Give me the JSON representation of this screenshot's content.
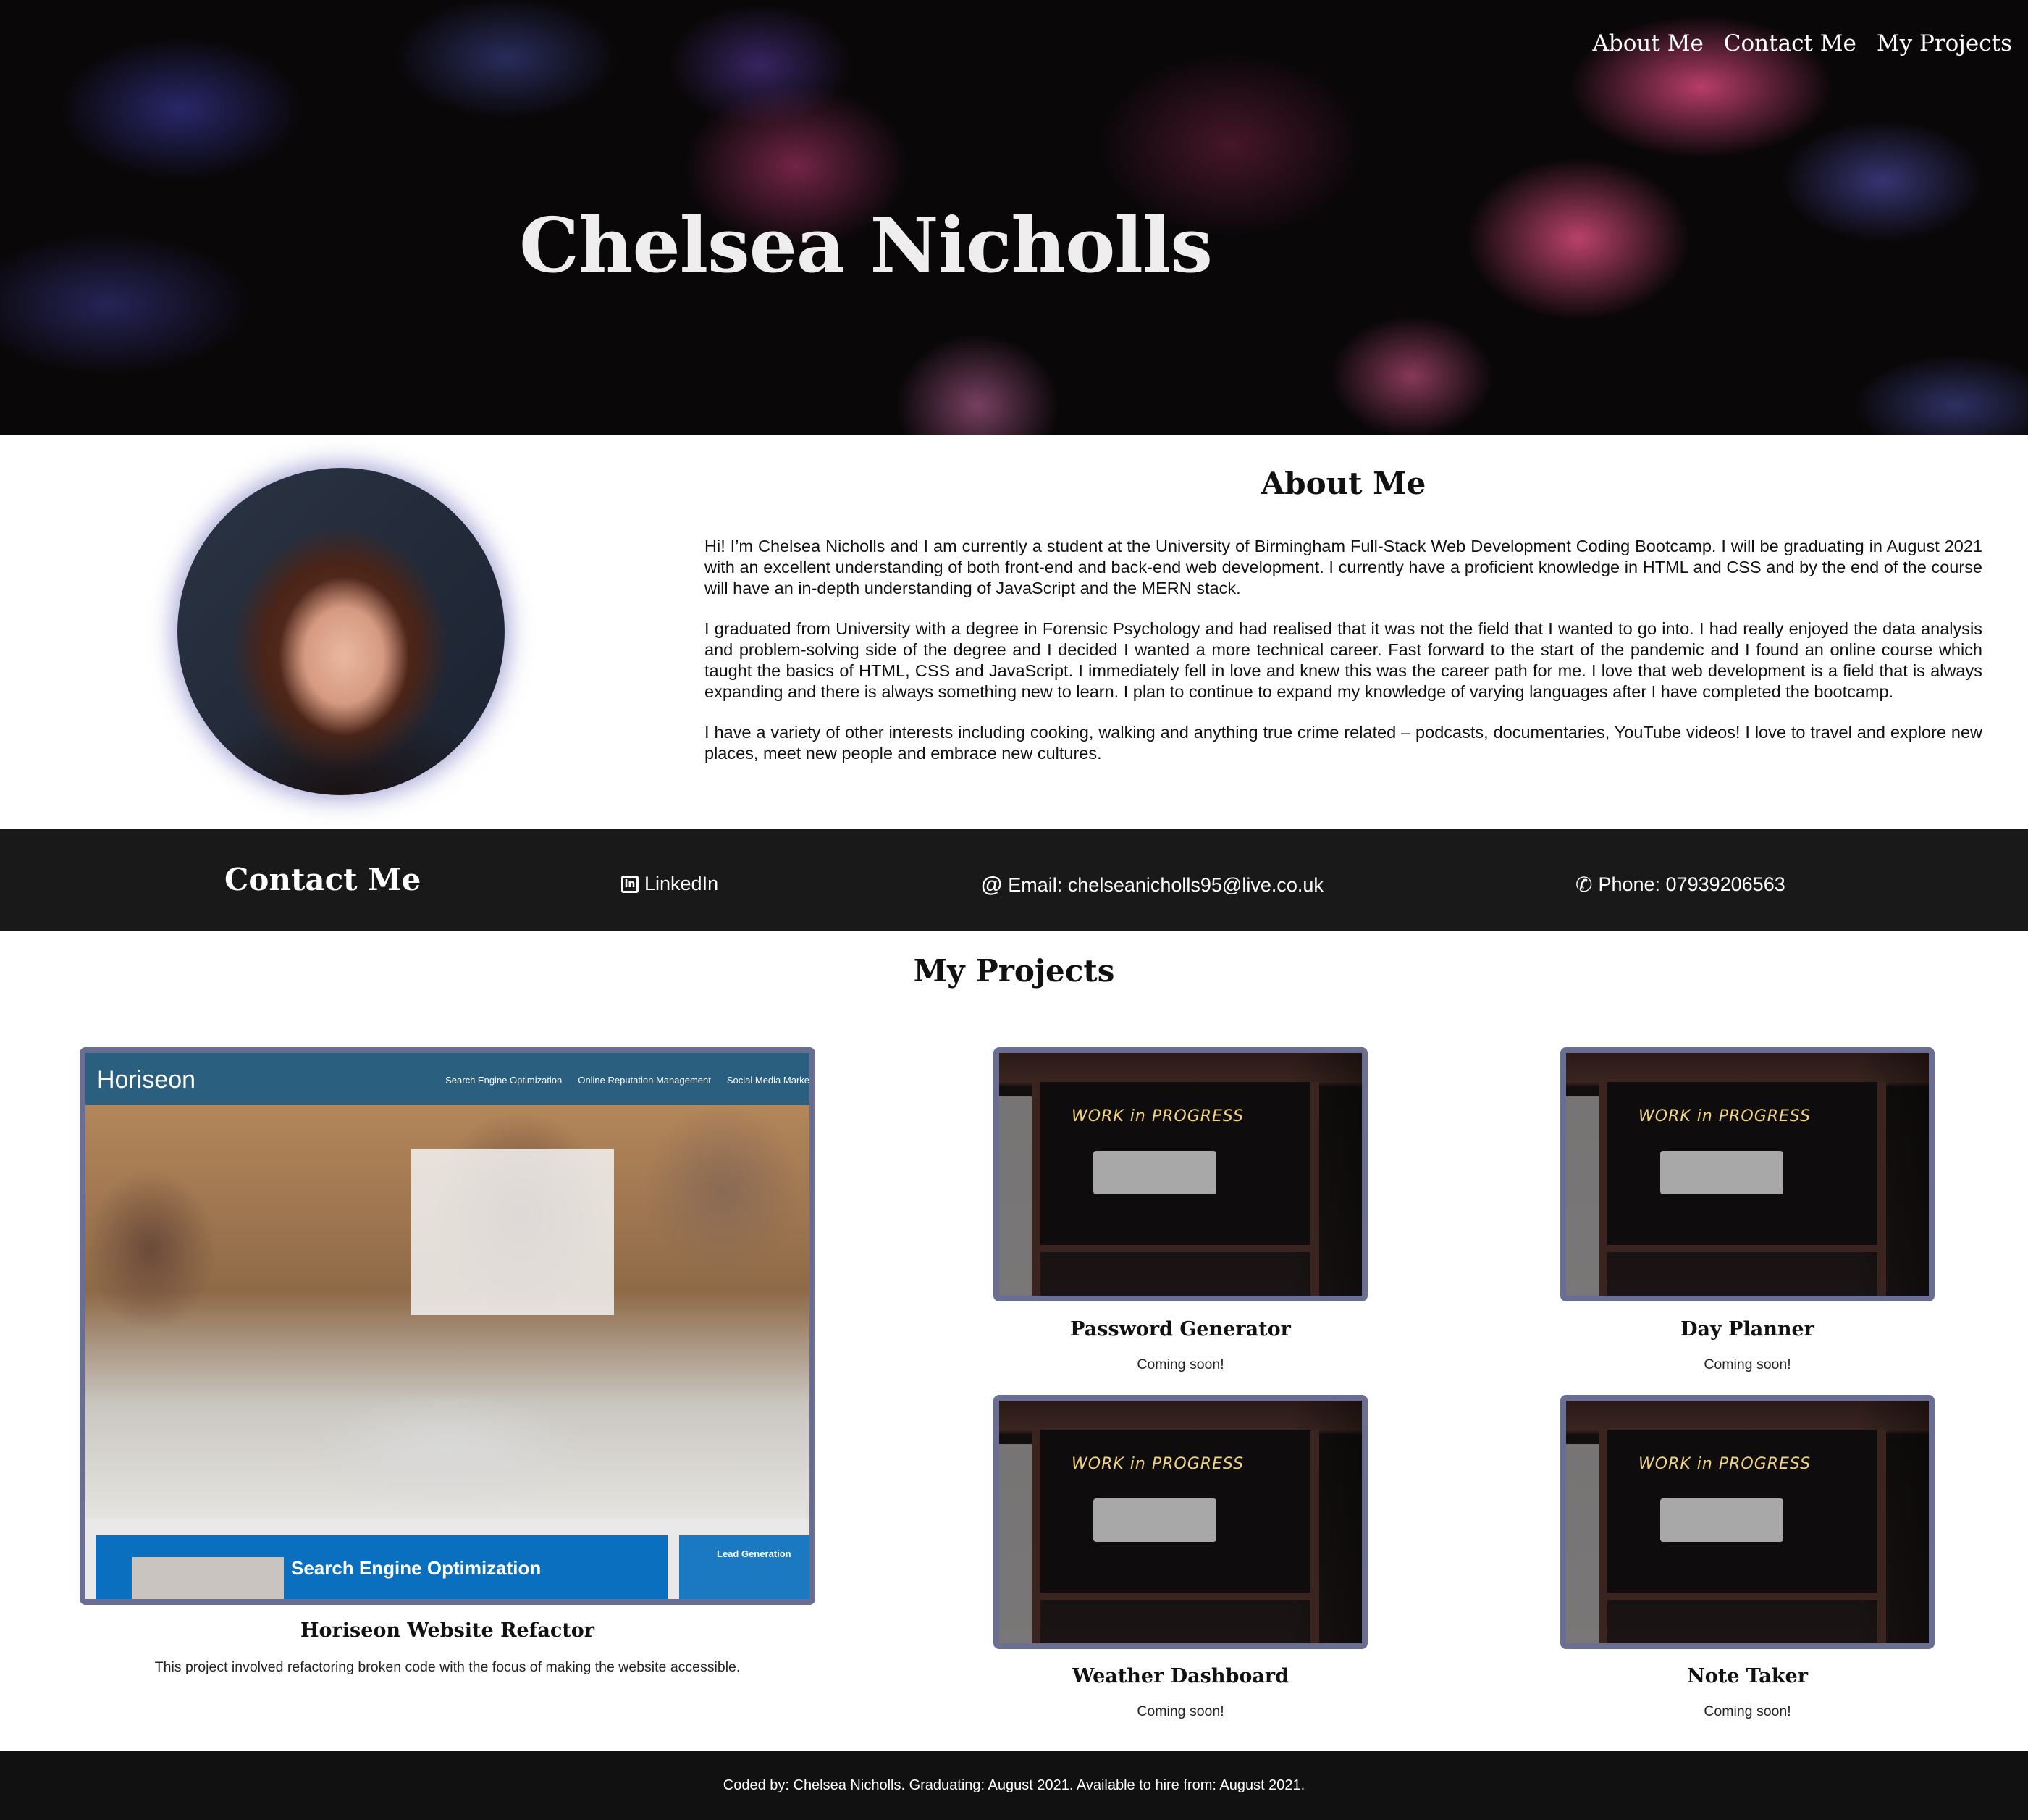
{
  "nav": {
    "items": [
      {
        "label": "About Me"
      },
      {
        "label": "Contact Me"
      },
      {
        "label": "My Projects"
      }
    ]
  },
  "hero": {
    "title": "Chelsea Nicholls"
  },
  "about": {
    "heading": "About Me",
    "paragraphs": [
      "Hi! I’m Chelsea Nicholls and I am currently a student at the University of Birmingham Full-Stack Web Development Coding Bootcamp. I will be graduating in August 2021 with an excellent understanding of both front-end and back-end web development. I currently have a proficient knowledge in HTML and CSS and by the end of the course will have an in-depth understanding of JavaScript and the MERN stack.",
      "I graduated from University with a degree in Forensic Psychology and had realised that it was not the field that I wanted to go into. I had really enjoyed the data analysis and problem-solving side of the degree and I decided I wanted a more technical career. Fast forward to the start of the pandemic and I found an online course which taught the basics of HTML, CSS and JavaScript. I immediately fell in love and knew this was the career path for me. I love that web development is a field that is always expanding and there is always something new to learn. I plan to continue to expand my knowledge of varying languages after I have completed the bootcamp.",
      "I have a variety of other interests including cooking, walking and anything true crime related – podcasts, documentaries, YouTube videos! I love to travel and explore new places, meet new people and embrace new cultures."
    ]
  },
  "contact": {
    "heading": "Contact Me",
    "linkedin": "LinkedIn",
    "email": "Email: chelseanicholls95@live.co.uk",
    "phone": "Phone: 07939206563",
    "icons": {
      "linkedin": "linkedin-icon",
      "email": "at-icon",
      "phone": "phone-icon"
    }
  },
  "projects": {
    "heading": "My Projects",
    "featured": {
      "title": "Horiseon Website Refactor",
      "description": "This project involved refactoring broken code with the focus of making the website accessible.",
      "screenshot": {
        "logo": "Horiseon",
        "nav_links": [
          "Search Engine Optimization",
          "Online Reputation Management",
          "Social Media Marke"
        ],
        "banner_title": "Search Engine Optimization",
        "side_title": "Lead Generation"
      }
    },
    "items": [
      {
        "title": "Password Generator",
        "description": "Coming soon!",
        "image_text": "WORK in PROGRESS"
      },
      {
        "title": "Day Planner",
        "description": "Coming soon!",
        "image_text": "WORK in PROGRESS"
      },
      {
        "title": "Weather Dashboard",
        "description": "Coming soon!",
        "image_text": "WORK in PROGRESS"
      },
      {
        "title": "Note Taker",
        "description": "Coming soon!",
        "image_text": "WORK in PROGRESS"
      }
    ]
  },
  "footer": {
    "text": "Coded by: Chelsea Nicholls. Graduating: August 2021. Available to hire from: August 2021."
  },
  "colors": {
    "contact_bar": "#191919",
    "footer": "#111111",
    "image_border": "#6a6e92",
    "hero_title": "#eeeeee"
  }
}
